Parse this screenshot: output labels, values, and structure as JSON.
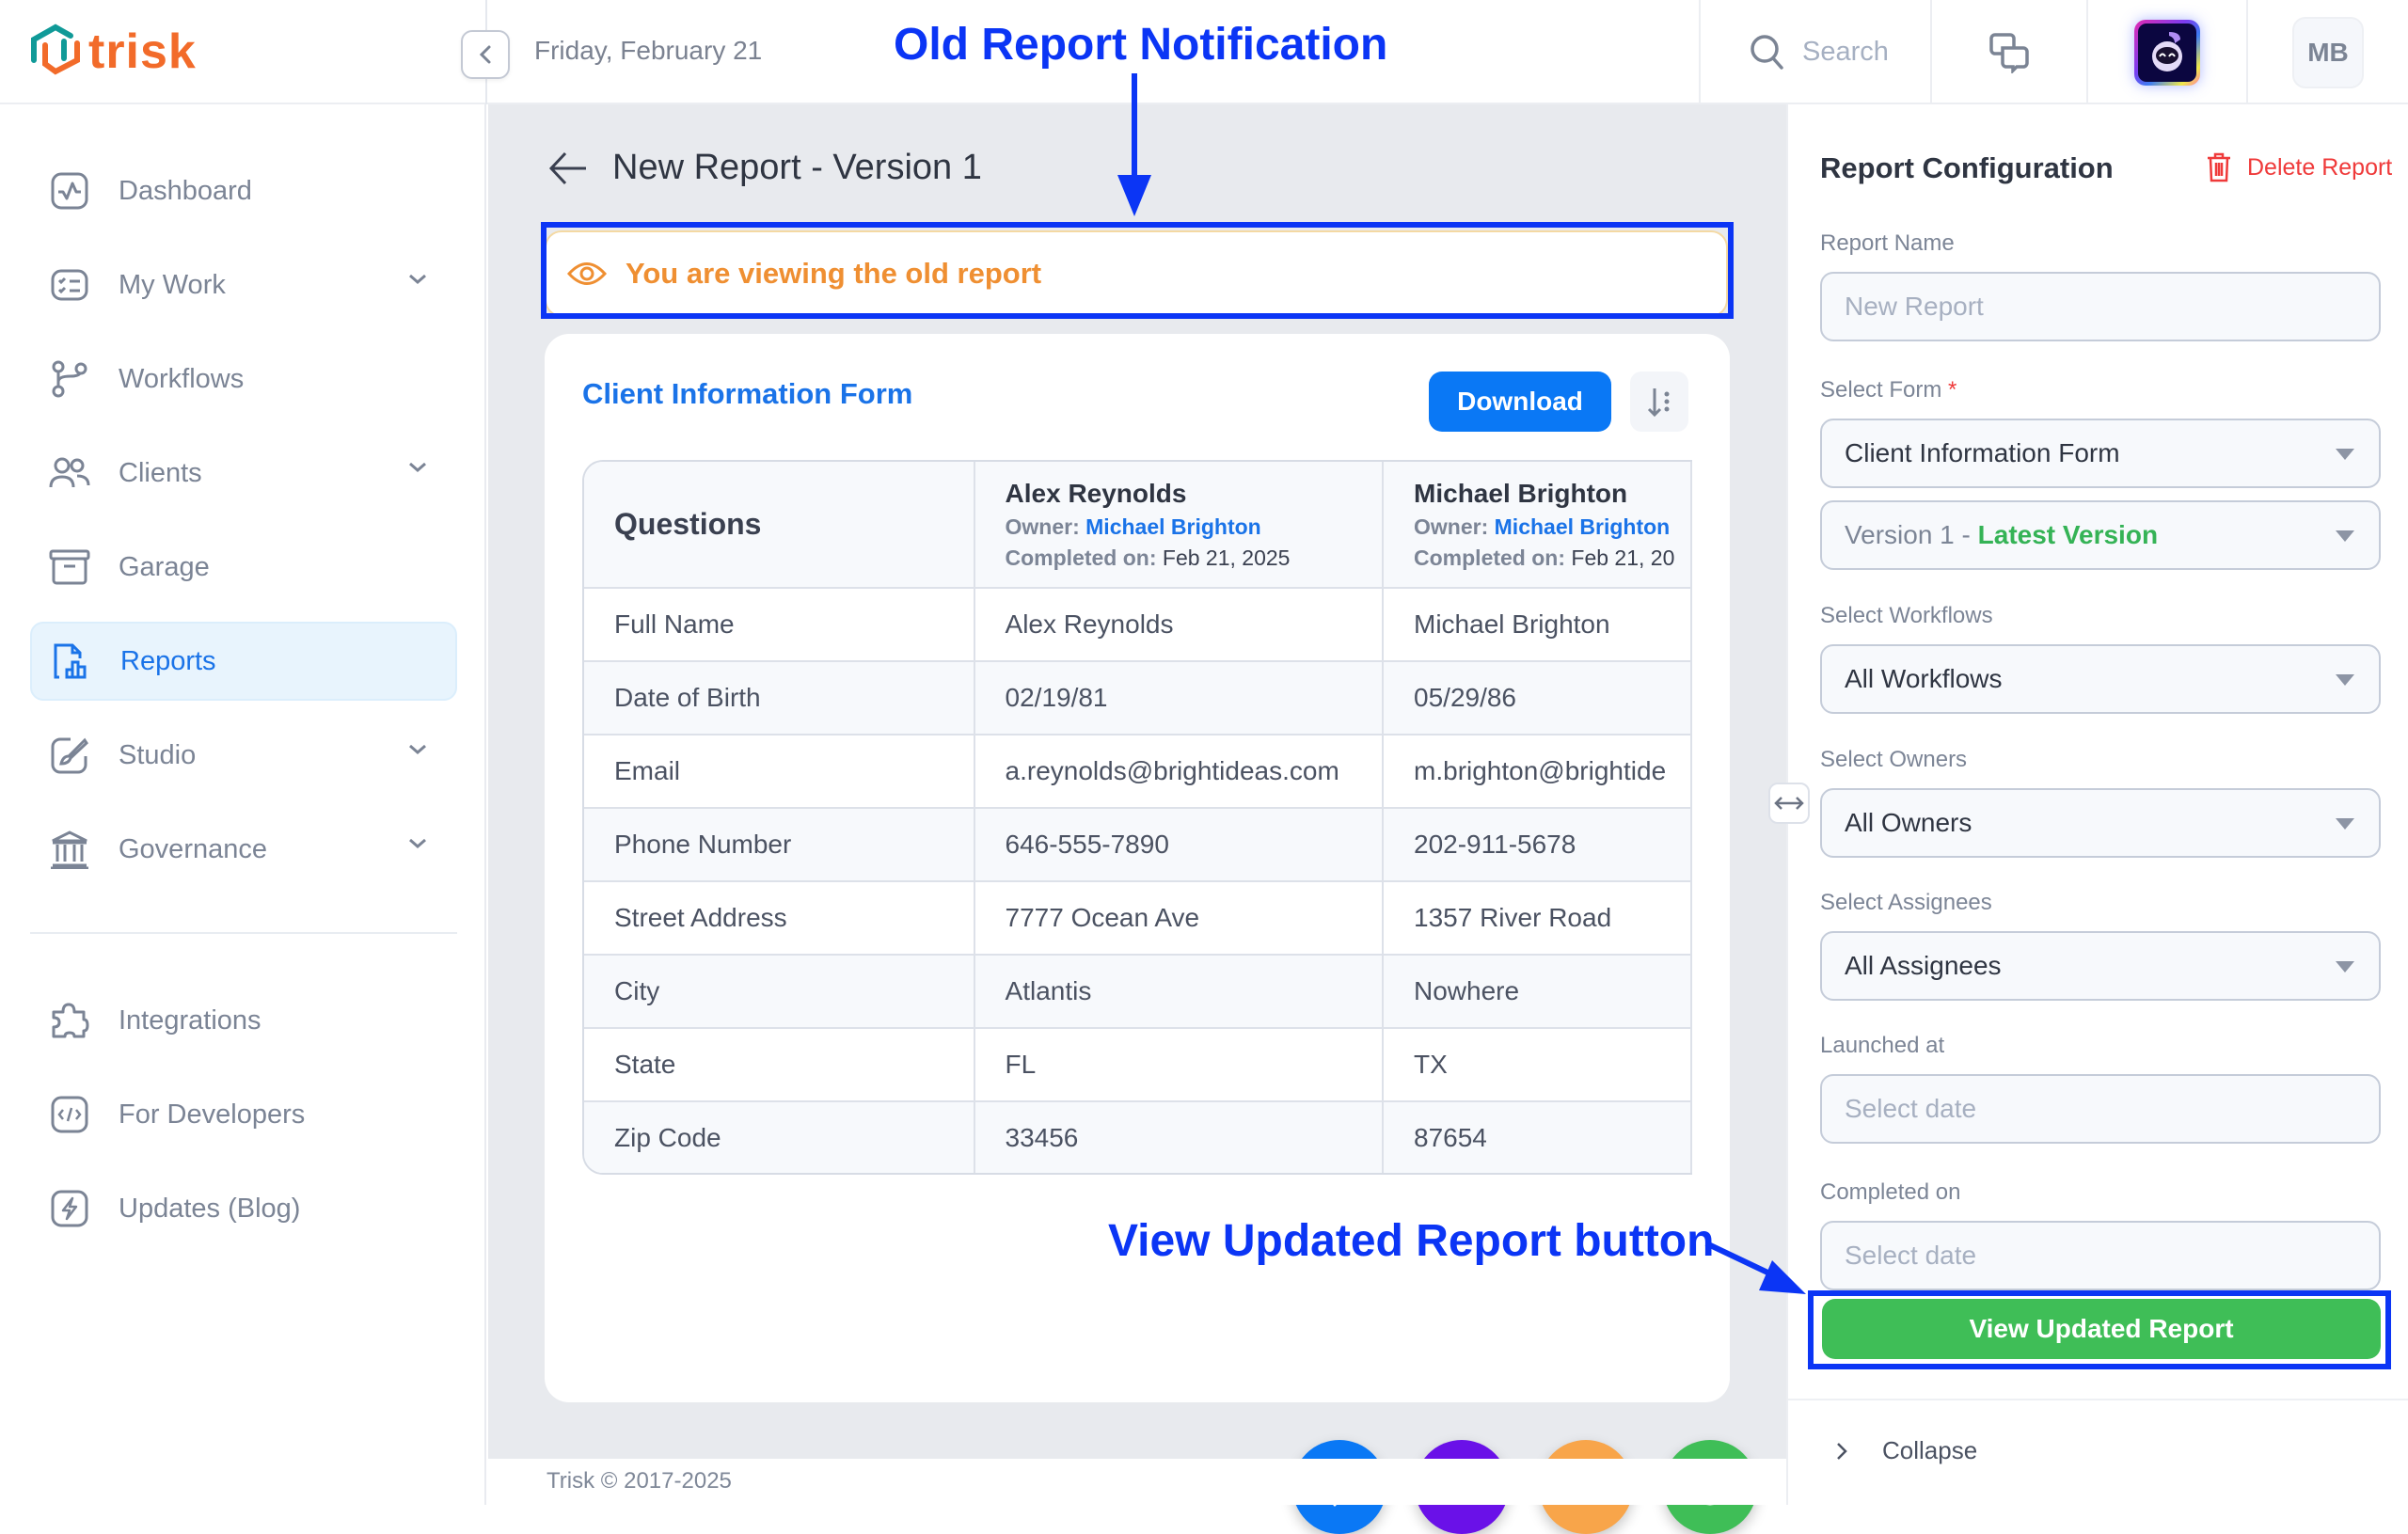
{
  "app": {
    "logo_text": "trisk",
    "brand_color": "#f26b2a"
  },
  "topbar": {
    "date": "Friday, February 21",
    "search_placeholder": "Search",
    "user_initials": "MB"
  },
  "sidebar": {
    "items": [
      {
        "label": "Dashboard",
        "icon": "activity-icon",
        "has_chevron": false,
        "active": false
      },
      {
        "label": "My Work",
        "icon": "checklist-icon",
        "has_chevron": true,
        "active": false
      },
      {
        "label": "Workflows",
        "icon": "branch-icon",
        "has_chevron": false,
        "active": false
      },
      {
        "label": "Clients",
        "icon": "users-icon",
        "has_chevron": true,
        "active": false
      },
      {
        "label": "Garage",
        "icon": "archive-icon",
        "has_chevron": false,
        "active": false
      },
      {
        "label": "Reports",
        "icon": "report-chart-icon",
        "has_chevron": false,
        "active": true
      },
      {
        "label": "Studio",
        "icon": "brush-icon",
        "has_chevron": true,
        "active": false
      },
      {
        "label": "Governance",
        "icon": "bank-icon",
        "has_chevron": true,
        "active": false
      }
    ],
    "secondary_items": [
      {
        "label": "Integrations",
        "icon": "puzzle-icon"
      },
      {
        "label": "For Developers",
        "icon": "code-icon"
      },
      {
        "label": "Updates (Blog)",
        "icon": "lightning-icon"
      }
    ]
  },
  "main": {
    "page_title": "New Report - Version 1",
    "notice": "You are viewing the old report",
    "card": {
      "title": "Client Information Form",
      "download_label": "Download",
      "table": {
        "questions_header": "Questions",
        "owner_label": "Owner:",
        "completed_label": "Completed on:",
        "respondents": [
          {
            "name": "Alex Reynolds",
            "owner": "Michael Brighton",
            "completed": "Feb 21, 2025"
          },
          {
            "name": "Michael Brighton",
            "owner": "Michael Brighton",
            "completed": "Feb 21, 20"
          }
        ],
        "rows": [
          {
            "question": "Full Name",
            "values": [
              "Alex Reynolds",
              "Michael Brighton"
            ]
          },
          {
            "question": "Date of Birth",
            "values": [
              "02/19/81",
              "05/29/86"
            ]
          },
          {
            "question": "Email",
            "values": [
              "a.reynolds@brightideas.com",
              "m.brighton@brightide"
            ]
          },
          {
            "question": "Phone Number",
            "values": [
              "646-555-7890",
              "202-911-5678"
            ]
          },
          {
            "question": "Street Address",
            "values": [
              "7777 Ocean Ave",
              "1357 River Road"
            ]
          },
          {
            "question": "City",
            "values": [
              "Atlantis",
              "Nowhere"
            ]
          },
          {
            "question": "State",
            "values": [
              "FL",
              "TX"
            ]
          },
          {
            "question": "Zip Code",
            "values": [
              "33456",
              "87654"
            ]
          }
        ]
      }
    },
    "fabs": [
      {
        "name": "quick-action",
        "icon": "lightning-icon",
        "color": "#0a78f5"
      },
      {
        "name": "launch",
        "icon": "rocket-icon",
        "color": "#6a11e8"
      },
      {
        "name": "garage",
        "icon": "archive-icon",
        "color": "#f8a54a"
      },
      {
        "name": "help",
        "icon": "question-icon",
        "color": "#3fbe57"
      }
    ],
    "footer": "Trisk © 2017-2025"
  },
  "annotations": {
    "old_report": "Old Report Notification",
    "view_button": "View Updated Report button",
    "color": "#0b35f5"
  },
  "panel": {
    "title": "Report Configuration",
    "delete_label": "Delete Report",
    "report_name_label": "Report Name",
    "report_name_placeholder": "New Report",
    "select_form_label": "Select Form",
    "required_mark": "*",
    "form_value": "Client Information Form",
    "version_prefix": "Version 1 - ",
    "version_suffix": "Latest Version",
    "workflows_label": "Select Workflows",
    "workflows_value": "All Workflows",
    "owners_label": "Select Owners",
    "owners_value": "All Owners",
    "assignees_label": "Select Assignees",
    "assignees_value": "All Assignees",
    "launched_label": "Launched at",
    "launched_placeholder": "Select date",
    "completed_label": "Completed on",
    "completed_placeholder": "Select date",
    "view_updated_label": "View Updated Report",
    "collapse_label": "Collapse"
  }
}
